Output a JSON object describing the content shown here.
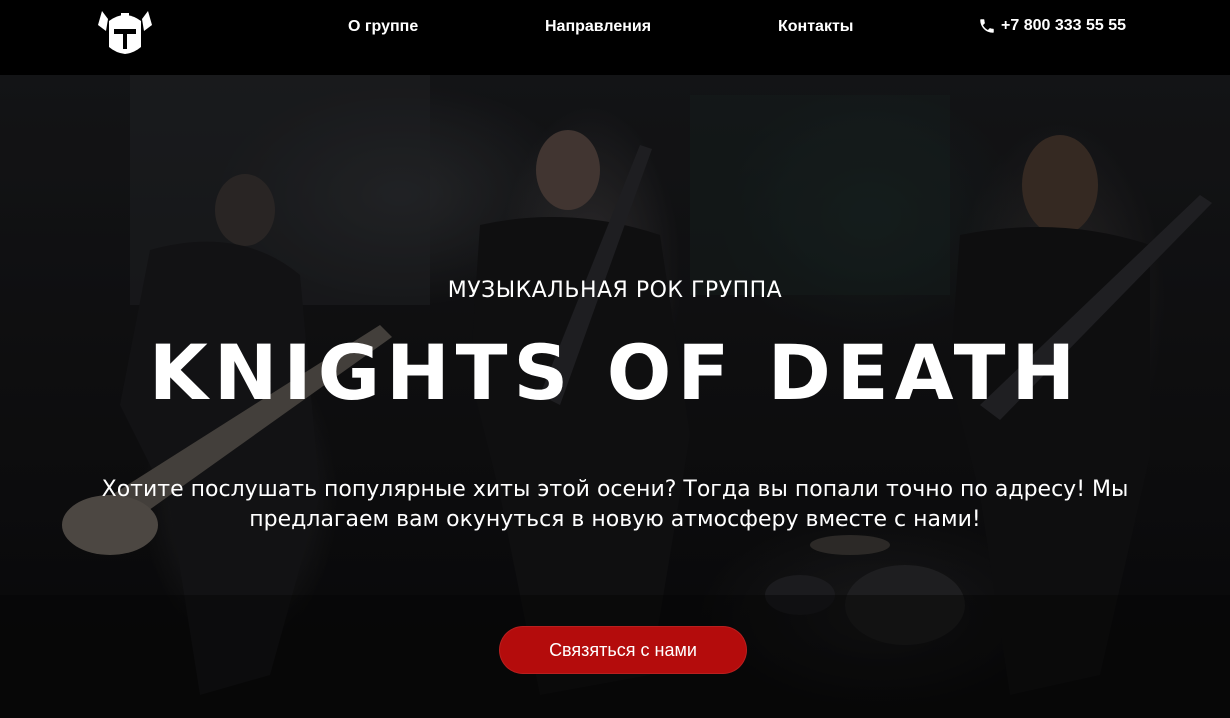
{
  "header": {
    "logo_name": "knight-helmet-logo",
    "nav": [
      {
        "label": "О группе"
      },
      {
        "label": "Направления"
      },
      {
        "label": "Контакты"
      }
    ],
    "phone": {
      "icon": "phone-icon",
      "number": "+7 800 333 55 55"
    }
  },
  "hero": {
    "tagline": "МУЗЫКАЛЬНАЯ РОК ГРУППА",
    "title": "KNIGHTS OF DEATH",
    "description": "Хотите послушать популярные хиты этой осени? Тогда вы попали точно по адресу! Мы предлагаем вам окунуться в новую атмосферу вместе с нами!",
    "cta_label": "Связяться с нами",
    "background": "concert-photo-band-on-stage"
  },
  "colors": {
    "header_bg": "#000000",
    "accent": "#b40c0c",
    "text": "#ffffff"
  }
}
